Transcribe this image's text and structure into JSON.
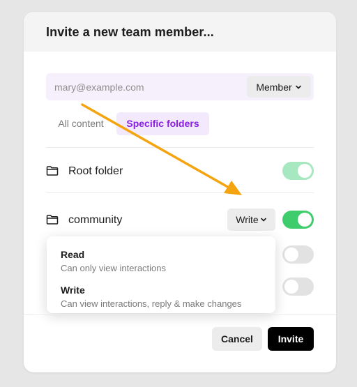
{
  "modal": {
    "title": "Invite a new team member...",
    "email": {
      "placeholder": "mary@example.com",
      "value": ""
    },
    "role_select": {
      "label": "Member"
    },
    "tabs": [
      {
        "label": "All content",
        "active": false
      },
      {
        "label": "Specific folders",
        "active": true
      }
    ],
    "folders": [
      {
        "name": "Root folder",
        "enabled": true,
        "dimmed": true
      },
      {
        "name": "community",
        "enabled": true,
        "permission": "Write"
      },
      {
        "name": "",
        "enabled": false
      },
      {
        "name": "",
        "enabled": false
      }
    ],
    "permission_menu": {
      "options": [
        {
          "title": "Read",
          "description": "Can only view interactions"
        },
        {
          "title": "Write",
          "description": "Can view interactions, reply & make changes"
        }
      ]
    },
    "buttons": {
      "cancel": "Cancel",
      "invite": "Invite"
    }
  },
  "colors": {
    "accent_purple": "#8a1de0",
    "toggle_on": "#3fcc6d",
    "toggle_on_dimmed": "#a8e8c0",
    "toggle_off": "#e2e2e2",
    "annotation_arrow": "#f4a40f"
  },
  "icons": [
    "folder-icon",
    "chevron-down-icon",
    "arrow-annotation"
  ]
}
